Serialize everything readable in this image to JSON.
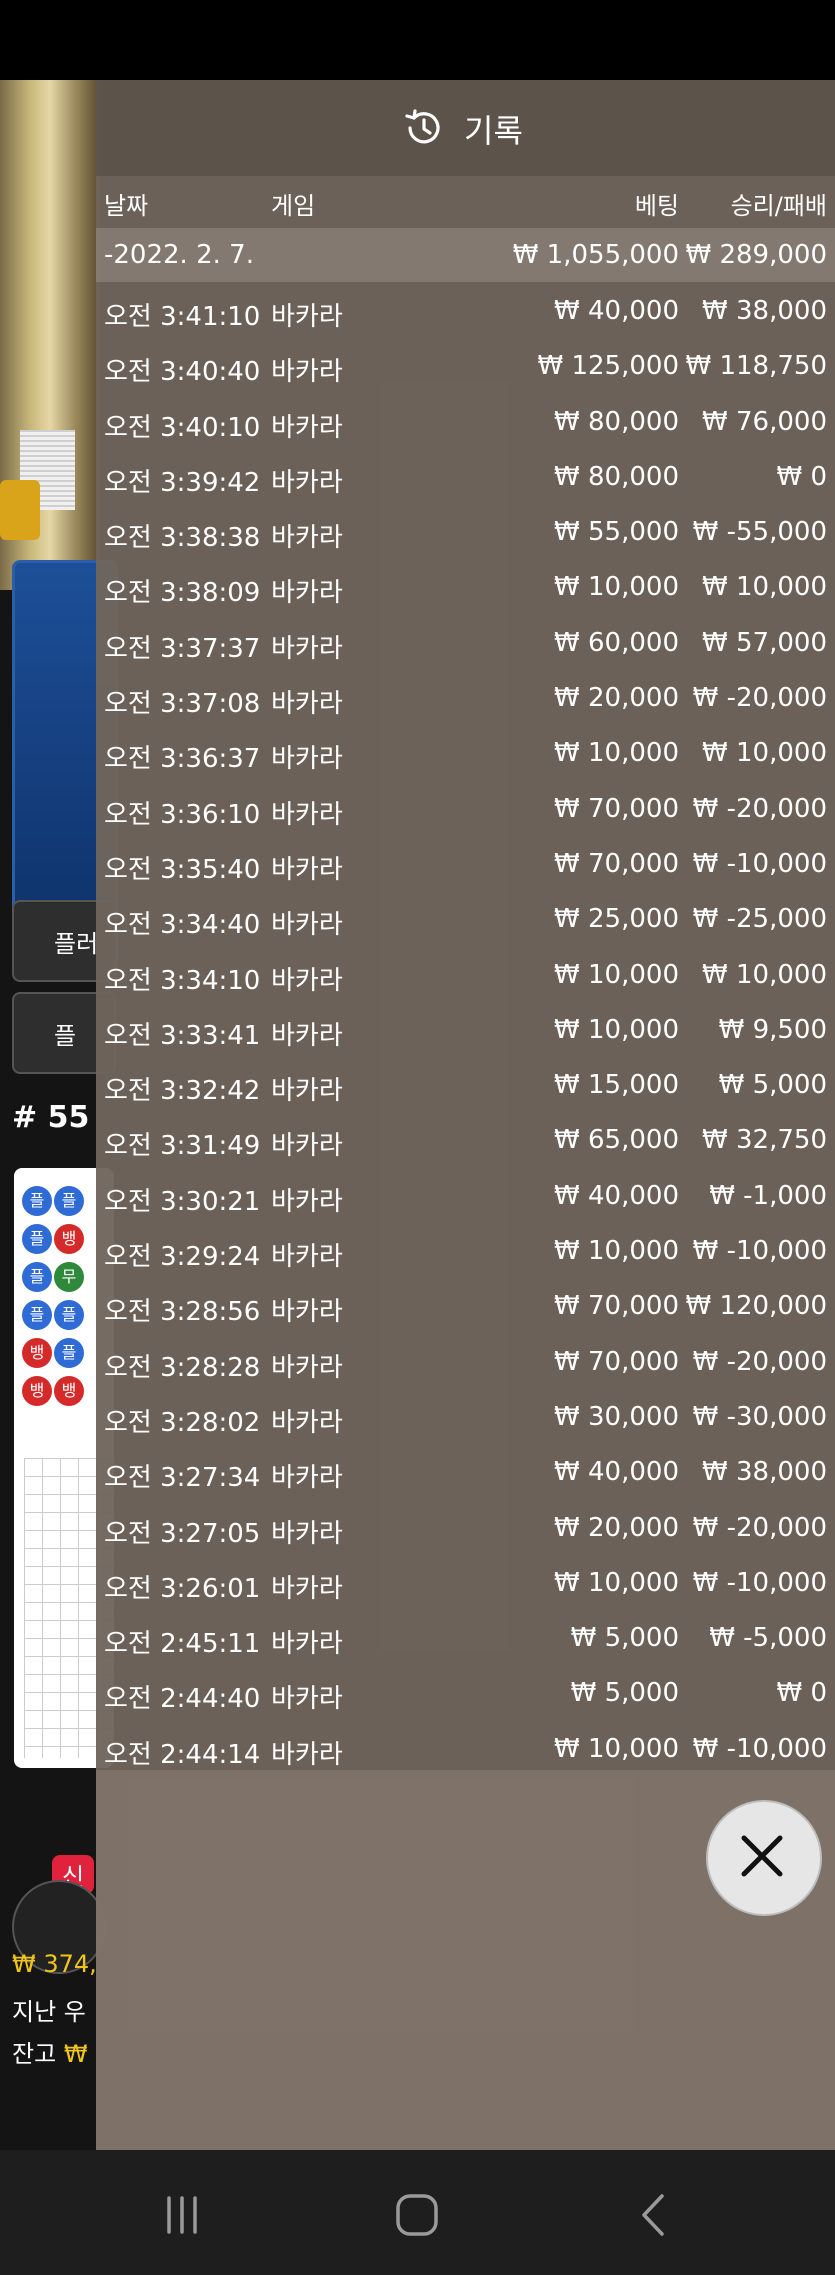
{
  "panel": {
    "title": "기록",
    "columns": {
      "date": "날짜",
      "game": "게임",
      "bet": "베팅",
      "result": "승리/패배"
    },
    "date_row": {
      "date": "-2022. 2. 7.",
      "bet_total": "₩ 1,055,000",
      "result_total": "₩ 289,000"
    },
    "rows": [
      {
        "time": "오전 3:41:10",
        "game": "바카라",
        "bet": "₩ 40,000",
        "result": "₩ 38,000"
      },
      {
        "time": "오전 3:40:40",
        "game": "바카라",
        "bet": "₩ 125,000",
        "result": "₩ 118,750"
      },
      {
        "time": "오전 3:40:10",
        "game": "바카라",
        "bet": "₩ 80,000",
        "result": "₩ 76,000"
      },
      {
        "time": "오전 3:39:42",
        "game": "바카라",
        "bet": "₩ 80,000",
        "result": "₩ 0"
      },
      {
        "time": "오전 3:38:38",
        "game": "바카라",
        "bet": "₩ 55,000",
        "result": "₩ -55,000"
      },
      {
        "time": "오전 3:38:09",
        "game": "바카라",
        "bet": "₩ 10,000",
        "result": "₩ 10,000"
      },
      {
        "time": "오전 3:37:37",
        "game": "바카라",
        "bet": "₩ 60,000",
        "result": "₩ 57,000"
      },
      {
        "time": "오전 3:37:08",
        "game": "바카라",
        "bet": "₩ 20,000",
        "result": "₩ -20,000"
      },
      {
        "time": "오전 3:36:37",
        "game": "바카라",
        "bet": "₩ 10,000",
        "result": "₩ 10,000"
      },
      {
        "time": "오전 3:36:10",
        "game": "바카라",
        "bet": "₩ 70,000",
        "result": "₩ -20,000"
      },
      {
        "time": "오전 3:35:40",
        "game": "바카라",
        "bet": "₩ 70,000",
        "result": "₩ -10,000"
      },
      {
        "time": "오전 3:34:40",
        "game": "바카라",
        "bet": "₩ 25,000",
        "result": "₩ -25,000"
      },
      {
        "time": "오전 3:34:10",
        "game": "바카라",
        "bet": "₩ 10,000",
        "result": "₩ 10,000"
      },
      {
        "time": "오전 3:33:41",
        "game": "바카라",
        "bet": "₩ 10,000",
        "result": "₩ 9,500"
      },
      {
        "time": "오전 3:32:42",
        "game": "바카라",
        "bet": "₩ 15,000",
        "result": "₩ 5,000"
      },
      {
        "time": "오전 3:31:49",
        "game": "바카라",
        "bet": "₩ 65,000",
        "result": "₩ 32,750"
      },
      {
        "time": "오전 3:30:21",
        "game": "바카라",
        "bet": "₩ 40,000",
        "result": "₩ -1,000"
      },
      {
        "time": "오전 3:29:24",
        "game": "바카라",
        "bet": "₩ 10,000",
        "result": "₩ -10,000"
      },
      {
        "time": "오전 3:28:56",
        "game": "바카라",
        "bet": "₩ 70,000",
        "result": "₩ 120,000"
      },
      {
        "time": "오전 3:28:28",
        "game": "바카라",
        "bet": "₩ 70,000",
        "result": "₩ -20,000"
      },
      {
        "time": "오전 3:28:02",
        "game": "바카라",
        "bet": "₩ 30,000",
        "result": "₩ -30,000"
      },
      {
        "time": "오전 3:27:34",
        "game": "바카라",
        "bet": "₩ 40,000",
        "result": "₩ 38,000"
      },
      {
        "time": "오전 3:27:05",
        "game": "바카라",
        "bet": "₩ 20,000",
        "result": "₩ -20,000"
      },
      {
        "time": "오전 3:26:01",
        "game": "바카라",
        "bet": "₩ 10,000",
        "result": "₩ -10,000"
      },
      {
        "time": "오전 2:45:11",
        "game": "바카라",
        "bet": "₩ 5,000",
        "result": "₩ -5,000"
      },
      {
        "time": "오전 2:44:40",
        "game": "바카라",
        "bet": "₩ 5,000",
        "result": "₩ 0"
      },
      {
        "time": "오전 2:44:14",
        "game": "바카라",
        "bet": "₩ 10,000",
        "result": "₩ -10,000"
      }
    ]
  },
  "background": {
    "player_zone_label": "플",
    "side_button_1": "플러",
    "side_button_2": "플",
    "round_label": "# 55",
    "beads": [
      "플",
      "플",
      "플",
      "뱅",
      "플",
      "무",
      "플",
      "플",
      "뱅",
      "플",
      "뱅",
      "뱅"
    ],
    "new_badge": "신",
    "balance_line": "₩ 374,",
    "last_win_label": "지난 우",
    "cash_label": "잔고",
    "cash_value": "₩"
  },
  "icons": {
    "history": "history-clock-icon",
    "close": "close-x-icon",
    "nav_recents": "recents-icon",
    "nav_home": "home-icon",
    "nav_back": "back-icon"
  },
  "colors": {
    "panel_bg": "#70655c",
    "player_blue": "#2f6bd4",
    "banker_red": "#d42a2a",
    "tie_green": "#2e8a3a",
    "gold": "#f0c419"
  }
}
